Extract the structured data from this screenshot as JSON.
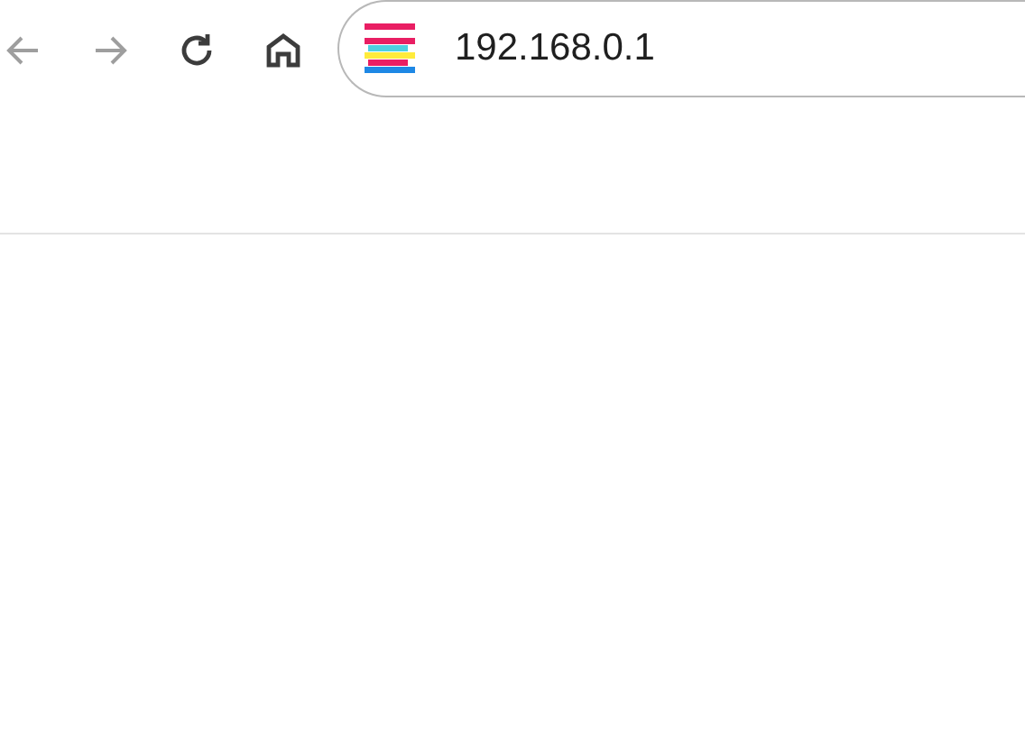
{
  "toolbar": {
    "buttons": [
      {
        "kind": "back",
        "disabled": true
      },
      {
        "kind": "forward",
        "disabled": true
      },
      {
        "kind": "reload",
        "disabled": false
      },
      {
        "kind": "home",
        "disabled": false
      }
    ]
  },
  "address_bar": {
    "value": "192.168.0.1"
  }
}
